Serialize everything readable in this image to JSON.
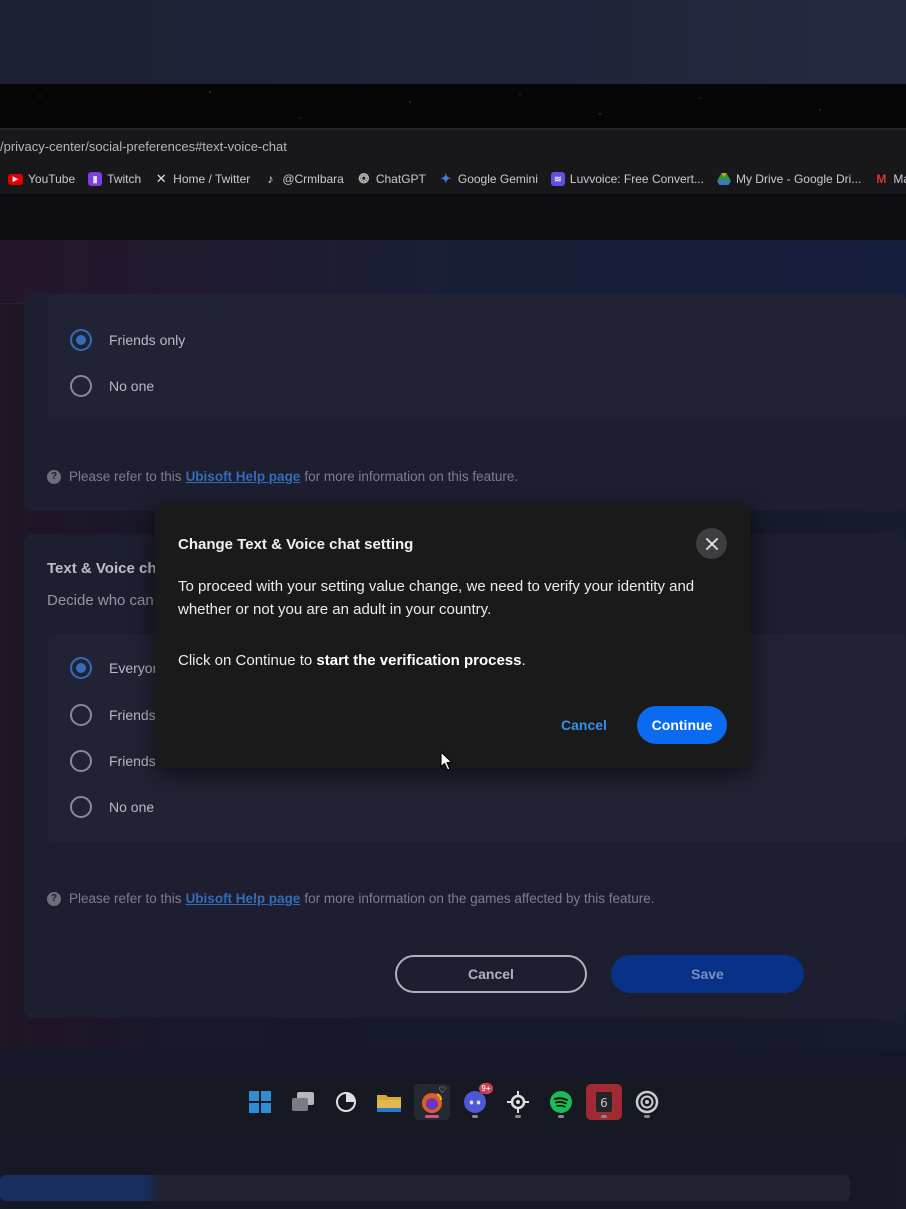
{
  "browser": {
    "url": "/privacy-center/social-preferences#text-voice-chat",
    "bookmarks": [
      {
        "label": "YouTube",
        "icon": "youtube-icon",
        "color": "#ff0000"
      },
      {
        "label": "Twitch",
        "icon": "twitch-icon",
        "color": "#9146ff"
      },
      {
        "label": "Home / Twitter",
        "icon": "x-icon",
        "color": "#ffffff"
      },
      {
        "label": "@Crmlbara",
        "icon": "tiktok-icon",
        "color": "#ffffff"
      },
      {
        "label": "ChatGPT",
        "icon": "chatgpt-icon",
        "color": "#cfcfcf"
      },
      {
        "label": "Google Gemini",
        "icon": "gemini-icon",
        "color": "#4a8cff"
      },
      {
        "label": "Luvvoice: Free Convert...",
        "icon": "luvvoice-icon",
        "color": "#6b5cff"
      },
      {
        "label": "My Drive - Google Dri...",
        "icon": "google-drive-icon",
        "color": "#34a853"
      },
      {
        "label": "Main Gma",
        "icon": "gmail-icon",
        "color": "#ea4335"
      }
    ]
  },
  "section_top": {
    "options": [
      {
        "label": "Friends only",
        "selected": true
      },
      {
        "label": "No one",
        "selected": false
      }
    ],
    "note_prefix": "Please refer to this",
    "note_link": "Ubisoft Help page",
    "note_suffix": "for more information on this feature."
  },
  "section_chat": {
    "title": "Text & Voice ch",
    "subtitle": "Decide who can",
    "options": [
      {
        "label": "Everyon",
        "selected": true
      },
      {
        "label": "Friends",
        "selected": false
      },
      {
        "label": "Friends",
        "selected": false
      },
      {
        "label": "No one",
        "selected": false
      }
    ],
    "note_prefix": "Please refer to this",
    "note_link": "Ubisoft Help page",
    "note_suffix": "for more information on the games affected by this feature.",
    "cancel_label": "Cancel",
    "save_label": "Save"
  },
  "dialog": {
    "title": "Change Text & Voice chat setting",
    "body": "To proceed with your setting value change, we need to verify your identity and whether or not you are an adult in your country.",
    "body2_prefix": "Click on Continue to ",
    "body2_bold": "start the verification process",
    "body2_suffix": ".",
    "cancel_label": "Cancel",
    "continue_label": "Continue"
  },
  "taskbar": {
    "discord_badge": "9+",
    "apps": [
      "windows-start-icon",
      "task-view-icon",
      "clock-app-icon",
      "file-explorer-icon",
      "firefox-icon",
      "discord-icon",
      "steelseries-icon",
      "spotify-icon",
      "rainbow-six-icon",
      "ubisoft-connect-icon"
    ]
  },
  "colors": {
    "accent": "#0a6bf0",
    "link": "#3a7bd5",
    "dialog_bg": "#1a1a1b"
  }
}
